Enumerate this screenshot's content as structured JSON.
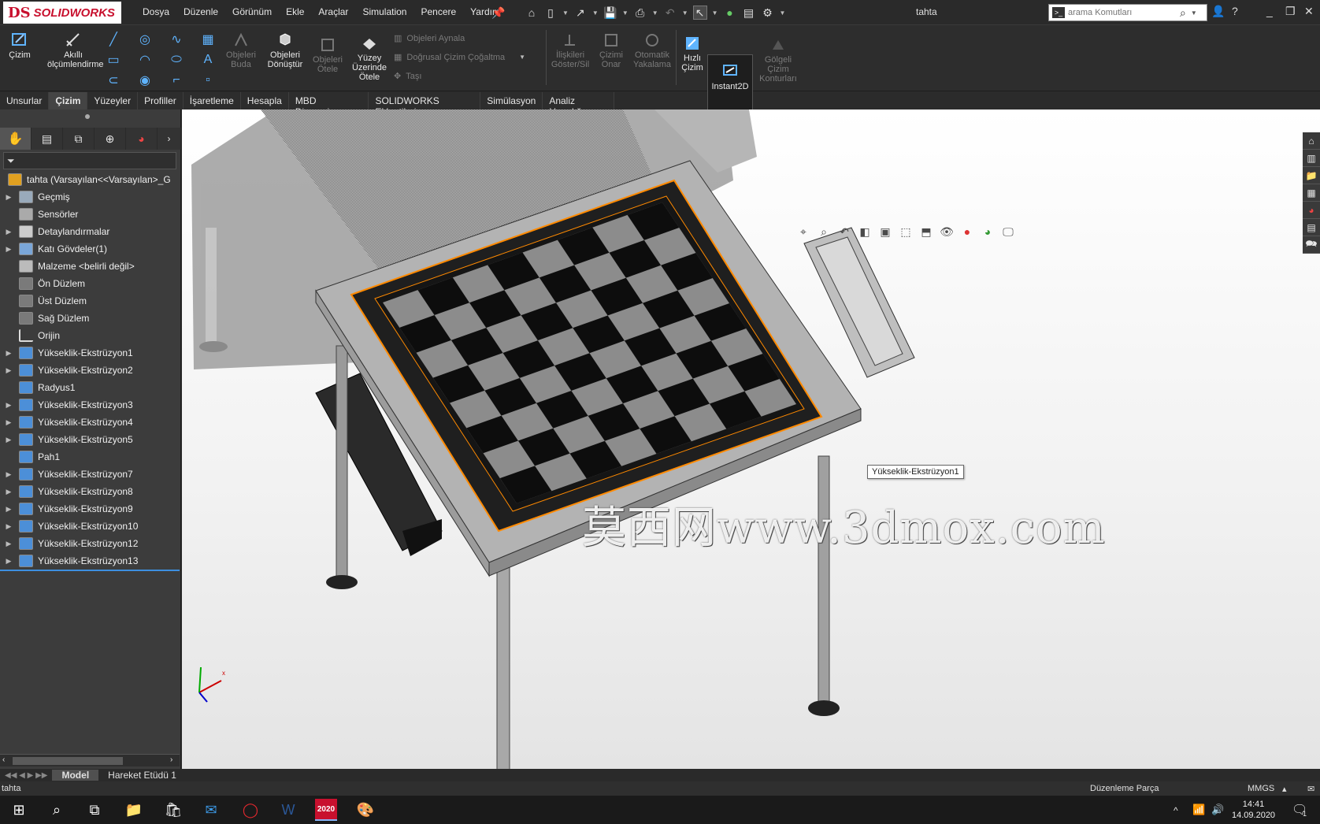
{
  "app": {
    "logo_ds": "DS",
    "logo_name": "SOLIDWORKS",
    "document_title": "tahta"
  },
  "menu": [
    "Dosya",
    "Düzenle",
    "Görünüm",
    "Ekle",
    "Araçlar",
    "Simulation",
    "Pencere",
    "Yardım"
  ],
  "search": {
    "placeholder": "arama Komutları"
  },
  "ribbon": {
    "cizim": "Çizim",
    "akilli_1": "Akıllı",
    "akilli_2": "ölçümlendirme",
    "objeleri_buda_1": "Objeleri",
    "objeleri_buda_2": "Buda",
    "objeleri_donustur_1": "Objeleri",
    "objeleri_donustur_2": "Dönüştür",
    "objeleri_otele_1": "Objeleri",
    "objeleri_otele_2": "Ötele",
    "yuzey_1": "Yüzey",
    "yuzey_2": "Üzerinde",
    "yuzey_3": "Ötele",
    "objeleri_aynala": "Objeleri Aynala",
    "dogrusal": "Doğrusal Çizim Çoğaltma",
    "tasi": "Taşı",
    "iliskileri_1": "İlişkileri",
    "iliskileri_2": "Göster/Sil",
    "cizimi_onar_1": "Çizimi",
    "cizimi_onar_2": "Onar",
    "otomatik_1": "Otomatik",
    "otomatik_2": "Yakalama",
    "hizli_1": "Hızlı",
    "hizli_2": "Çizim",
    "instant2d": "Instant2D",
    "golgeli_1": "Gölgeli",
    "golgeli_2": "Çizim",
    "golgeli_3": "Konturları"
  },
  "tabs": [
    "Unsurlar",
    "Çizim",
    "Yüzeyler",
    "Profiller",
    "İşaretleme",
    "Hesapla",
    "MBD Dimensions",
    "SOLIDWORKS Eklentileri",
    "Simülasyon",
    "Analiz Hazırlığı"
  ],
  "active_tab": "Çizim",
  "tree": {
    "root": "tahta  (Varsayılan<<Varsayılan>_G",
    "items": [
      {
        "label": "Geçmiş",
        "expandable": true,
        "icon": "history-icon"
      },
      {
        "label": "Sensörler",
        "expandable": false,
        "icon": "sensor-icon"
      },
      {
        "label": "Detaylandırmalar",
        "expandable": true,
        "icon": "annotation-icon"
      },
      {
        "label": "Katı Gövdeler(1)",
        "expandable": true,
        "icon": "solid-bodies-icon"
      },
      {
        "label": "Malzeme <belirli değil>",
        "expandable": false,
        "icon": "material-icon"
      },
      {
        "label": "Ön Düzlem",
        "expandable": false,
        "icon": "plane-icon"
      },
      {
        "label": "Üst Düzlem",
        "expandable": false,
        "icon": "plane-icon"
      },
      {
        "label": "Sağ Düzlem",
        "expandable": false,
        "icon": "plane-icon"
      },
      {
        "label": "Orijin",
        "expandable": false,
        "icon": "origin-icon"
      },
      {
        "label": "Yükseklik-Ekstrüzyon1",
        "expandable": true,
        "icon": "extrude-icon"
      },
      {
        "label": "Yükseklik-Ekstrüzyon2",
        "expandable": true,
        "icon": "extrude-icon"
      },
      {
        "label": "Radyus1",
        "expandable": false,
        "icon": "fillet-icon"
      },
      {
        "label": "Yükseklik-Ekstrüzyon3",
        "expandable": true,
        "icon": "extrude-icon"
      },
      {
        "label": "Yükseklik-Ekstrüzyon4",
        "expandable": true,
        "icon": "extrude-icon"
      },
      {
        "label": "Yükseklik-Ekstrüzyon5",
        "expandable": true,
        "icon": "extrude-icon"
      },
      {
        "label": "Pah1",
        "expandable": false,
        "icon": "chamfer-icon"
      },
      {
        "label": "Yükseklik-Ekstrüzyon7",
        "expandable": true,
        "icon": "extrude-icon"
      },
      {
        "label": "Yükseklik-Ekstrüzyon8",
        "expandable": true,
        "icon": "extrude-icon"
      },
      {
        "label": "Yükseklik-Ekstrüzyon9",
        "expandable": true,
        "icon": "extrude-icon"
      },
      {
        "label": "Yükseklik-Ekstrüzyon10",
        "expandable": true,
        "icon": "extrude-icon"
      },
      {
        "label": "Yükseklik-Ekstrüzyon12",
        "expandable": true,
        "icon": "extrude-icon"
      },
      {
        "label": "Yükseklik-Ekstrüzyon13",
        "expandable": true,
        "icon": "extrude-icon"
      }
    ]
  },
  "viewport": {
    "tooltip": "Yükseklik-Ekstrüzyon1",
    "watermark": "莫西网www.3dmox.com",
    "triad_x": "x"
  },
  "bottom_tabs": [
    "Model",
    "Hareket Etüdü 1"
  ],
  "status": {
    "left": "tahta",
    "mode": "Düzenleme Parça",
    "units": "MMGS"
  },
  "taskbar": {
    "time": "14:41",
    "date": "14.09.2020",
    "sw_badge": "2020",
    "notifications": "1"
  },
  "colors": {
    "accent_red": "#c8102e",
    "selection_blue": "#3d8fe0",
    "highlight_orange": "#ff8a00"
  }
}
